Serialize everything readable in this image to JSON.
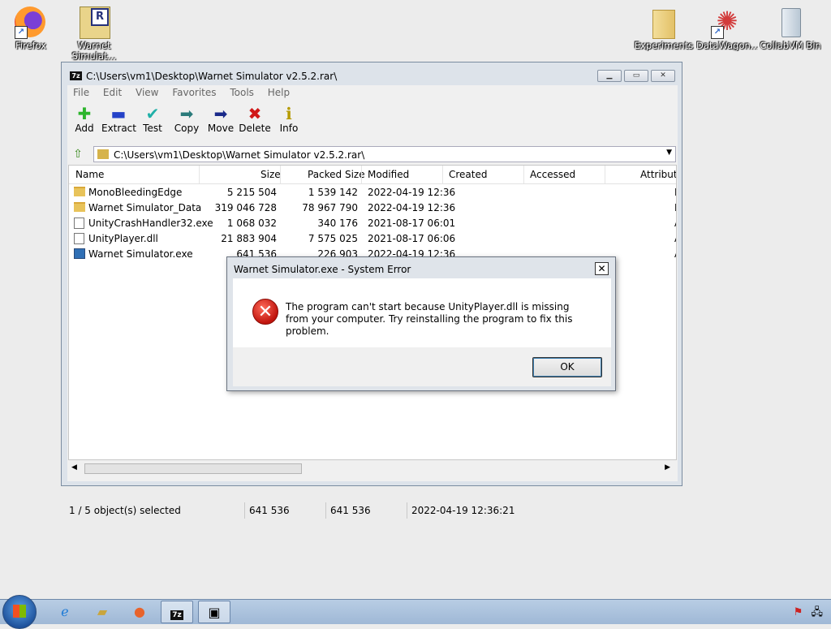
{
  "desktop_icons": [
    {
      "label": "Firefox"
    },
    {
      "label": "Warnet Simulat..."
    },
    {
      "label": "Experiments"
    },
    {
      "label": "DataWagon..."
    },
    {
      "label": "CollabVM Bin"
    }
  ],
  "window": {
    "title": "C:\\Users\\vm1\\Desktop\\Warnet Simulator v2.5.2.rar\\",
    "app_icon_text": "7z",
    "menu": [
      "File",
      "Edit",
      "View",
      "Favorites",
      "Tools",
      "Help"
    ],
    "toolbar": [
      {
        "label": "Add",
        "icon": "plus-icon",
        "glyph": "✚",
        "color": "#2db52d"
      },
      {
        "label": "Extract",
        "icon": "minus-icon",
        "glyph": "▬",
        "color": "#2442c8"
      },
      {
        "label": "Test",
        "icon": "check-icon",
        "glyph": "✔",
        "color": "#20b0a8"
      },
      {
        "label": "Copy",
        "icon": "copy-arrow-icon",
        "glyph": "➡",
        "color": "#2a7a7a"
      },
      {
        "label": "Move",
        "icon": "move-arrow-icon",
        "glyph": "➡",
        "color": "#1a2a8a"
      },
      {
        "label": "Delete",
        "icon": "delete-x-icon",
        "glyph": "✖",
        "color": "#d01818"
      },
      {
        "label": "Info",
        "icon": "info-icon",
        "glyph": "ℹ",
        "color": "#b59a00"
      }
    ],
    "address": "C:\\Users\\vm1\\Desktop\\Warnet Simulator v2.5.2.rar\\",
    "columns": [
      "Name",
      "Size",
      "Packed Size",
      "Modified",
      "Created",
      "Accessed",
      "Attributes"
    ],
    "files": [
      {
        "name": "MonoBleedingEdge",
        "size": "5 215 504",
        "packed": "1 539 142",
        "modified": "2022-04-19 12:36",
        "attr": "D",
        "type": "folder"
      },
      {
        "name": "Warnet Simulator_Data",
        "size": "319 046 728",
        "packed": "78 967 790",
        "modified": "2022-04-19 12:36",
        "attr": "D",
        "type": "folder"
      },
      {
        "name": "UnityCrashHandler32.exe",
        "size": "1 068 032",
        "packed": "340 176",
        "modified": "2021-08-17 06:01",
        "attr": "A",
        "type": "exe-generic"
      },
      {
        "name": "UnityPlayer.dll",
        "size": "21 883 904",
        "packed": "7 575 025",
        "modified": "2021-08-17 06:06",
        "attr": "A",
        "type": "dll"
      },
      {
        "name": "Warnet Simulator.exe",
        "size": "641 536",
        "packed": "226 903",
        "modified": "2022-04-19 12:36",
        "attr": "A",
        "type": "exe"
      }
    ],
    "status": {
      "selection": "1 / 5 object(s) selected",
      "size": "641 536",
      "packed": "641 536",
      "modified": "2022-04-19 12:36:21"
    }
  },
  "dialog": {
    "title": "Warnet Simulator.exe - System Error",
    "message": "The program can't start because UnityPlayer.dll is missing from your computer. Try reinstalling the program to fix this problem.",
    "ok_label": "OK",
    "close_glyph": "✕",
    "icon": "error-x-icon"
  },
  "taskbar": {
    "items": [
      "ie-icon",
      "explorer-icon",
      "firefox-icon",
      "7zip-icon",
      "window-icon"
    ],
    "tray": [
      "action-center-flag-icon",
      "network-icon"
    ]
  }
}
